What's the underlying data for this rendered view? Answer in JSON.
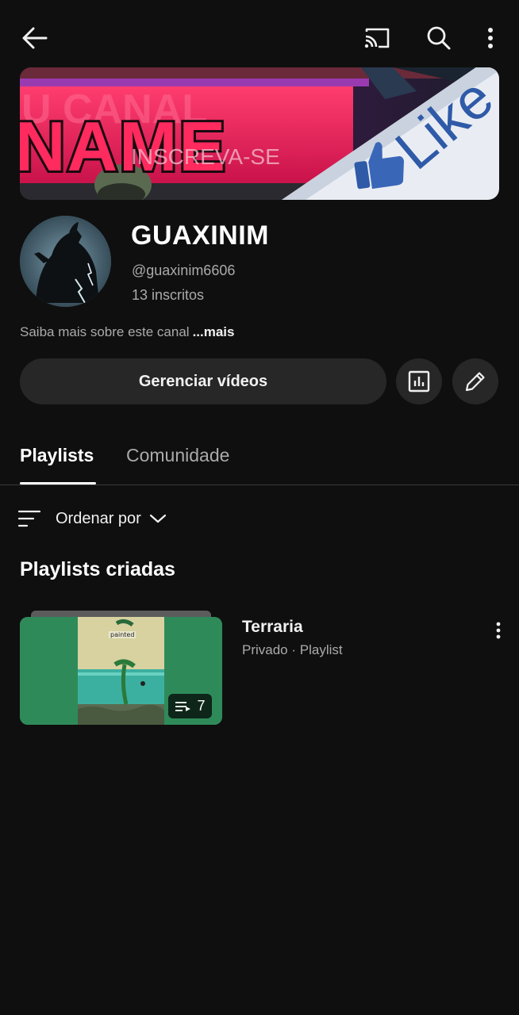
{
  "header": {
    "back_icon": "arrow-left-icon",
    "cast_icon": "cast-icon",
    "search_icon": "search-icon",
    "more_icon": "more-vertical-icon"
  },
  "banner": {
    "text_main": "NAME",
    "text_canal": "U CANAL",
    "text_subscribe": "INSCREVA-SE",
    "text_like": "Like",
    "colors": {
      "pink": "#e8205a",
      "purple": "#4a1858",
      "white_band": "#e8ecf2",
      "like_blue": "#2f5aa8"
    }
  },
  "channel": {
    "name": "GUAXINIM",
    "handle": "@guaxinim6606",
    "subscribers": "13 inscritos",
    "about": "Saiba mais sobre este canal",
    "about_more": "...mais"
  },
  "actions": {
    "manage_videos": "Gerenciar vídeos",
    "stats_icon": "bar-chart-icon",
    "edit_icon": "pencil-icon"
  },
  "tabs": [
    {
      "label": "Playlists",
      "selected": true
    },
    {
      "label": "Comunidade",
      "selected": false
    }
  ],
  "sort": {
    "label": "Ordenar por",
    "icon": "sort-lines-icon",
    "chevron": "chevron-down-icon"
  },
  "section": {
    "title": "Playlists criadas"
  },
  "playlists": [
    {
      "title": "Terraria",
      "meta": "Privado · Playlist",
      "video_count": "7",
      "thumb_label": "painted",
      "count_icon": "playlist-icon",
      "menu_icon": "more-vertical-icon"
    }
  ],
  "colors": {
    "background": "#0f0f0f",
    "surface": "#272727",
    "text_primary": "#f1f1f1",
    "text_secondary": "#aaaaaa"
  }
}
